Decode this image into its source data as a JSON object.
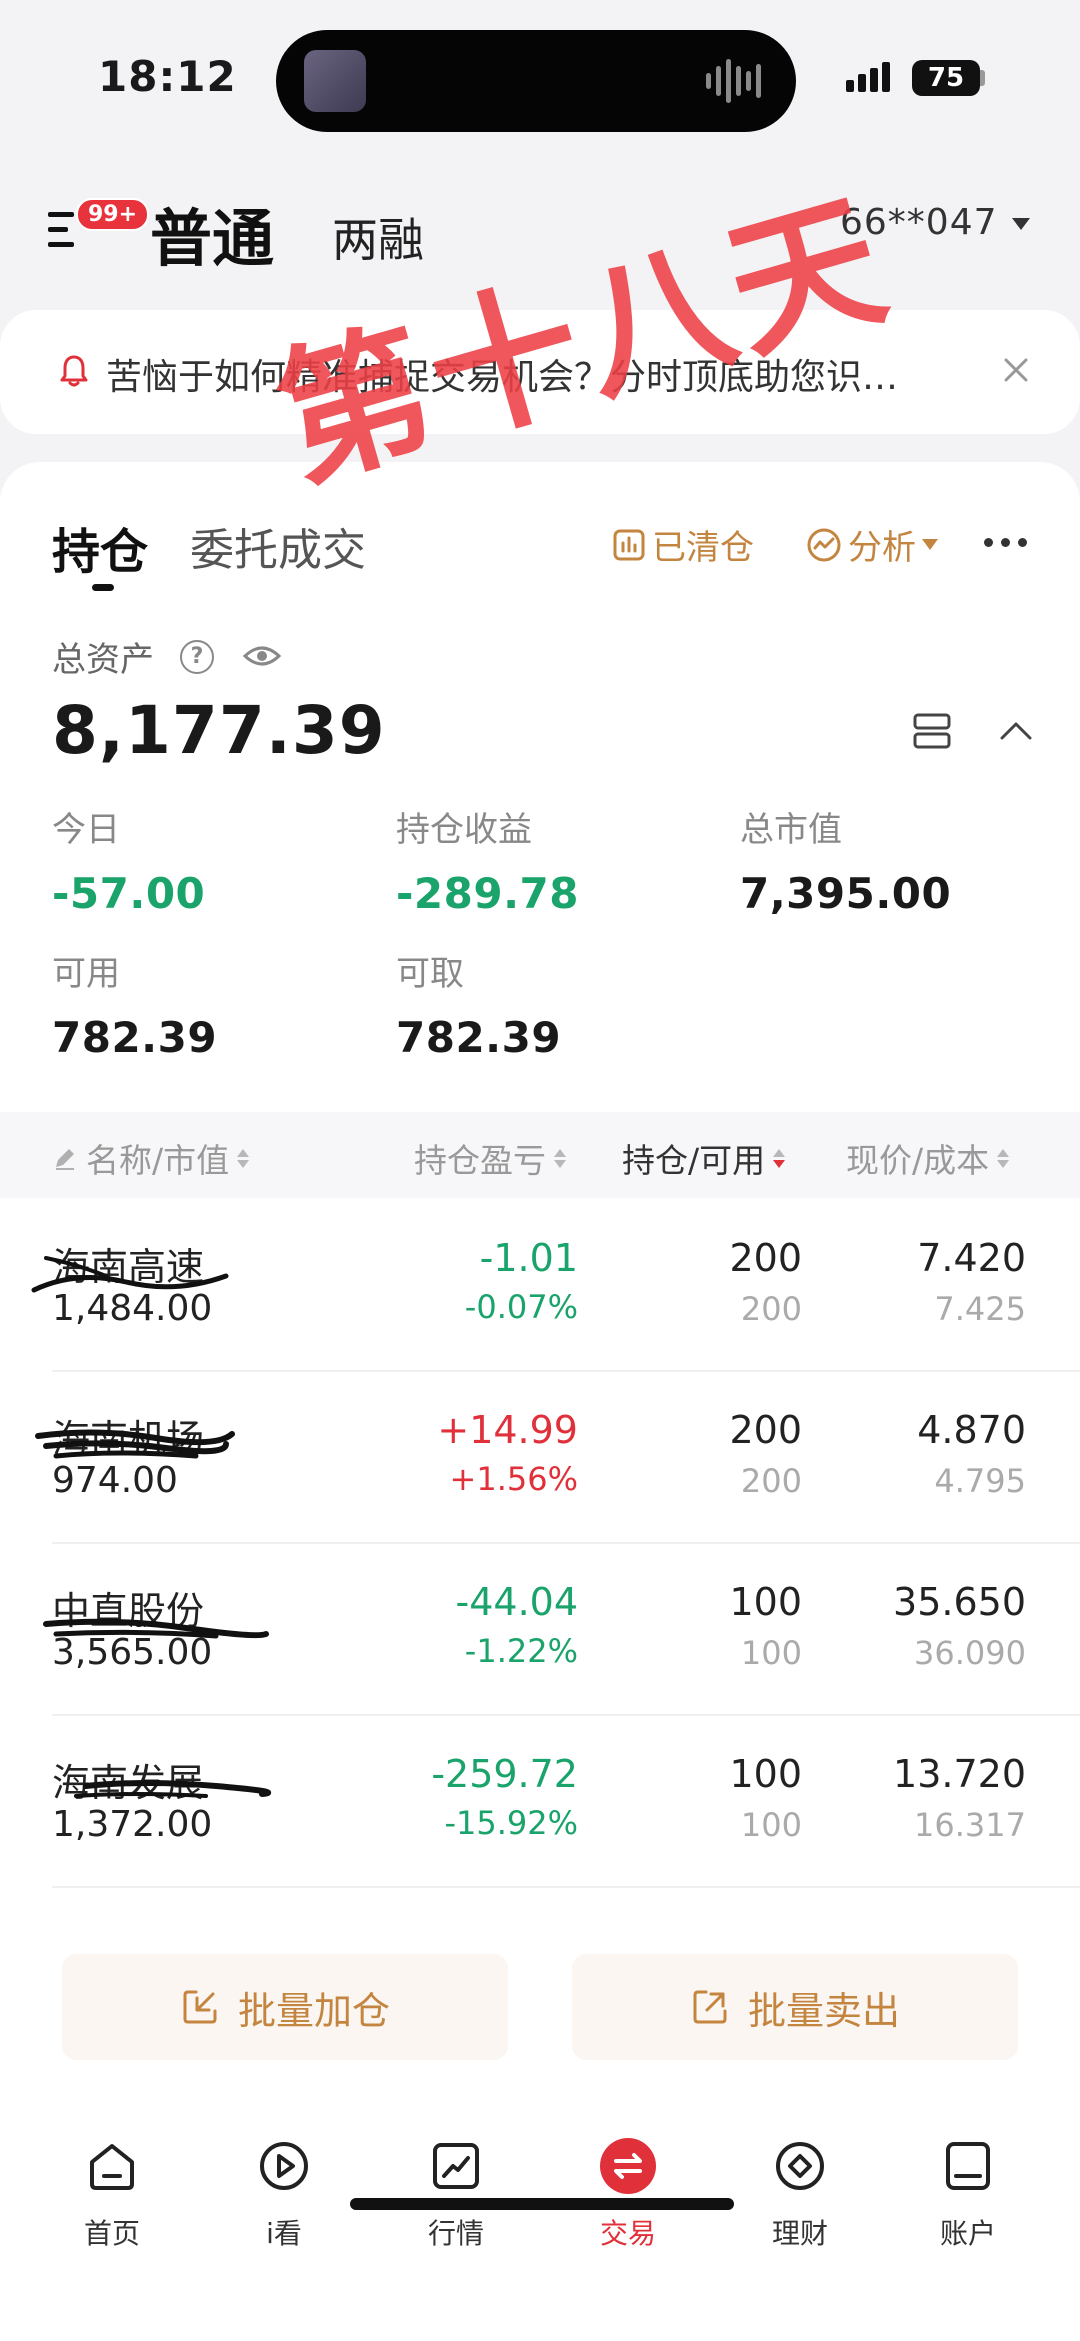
{
  "status_bar": {
    "time": "18:12",
    "battery": "75"
  },
  "header": {
    "badge": "99+",
    "tab_normal": "普通",
    "tab_margin": "两融",
    "account": "66**047"
  },
  "notice": {
    "text": "苦恼于如何精准捕捉交易机会？分时顶底助您识…"
  },
  "tabs": {
    "holdings": "持仓",
    "orders": "委托成交"
  },
  "actions": {
    "cleared": "已清仓",
    "analysis": "分析"
  },
  "assets": {
    "total_label": "总资产",
    "total_value": "8,177.39",
    "today_label": "今日",
    "today_value": "-57.00",
    "position_pl_label": "持仓收益",
    "position_pl_value": "-289.78",
    "market_value_label": "总市值",
    "market_value_value": "7,395.00",
    "available_label": "可用",
    "available_value": "782.39",
    "withdrawable_label": "可取",
    "withdrawable_value": "782.39"
  },
  "table": {
    "headers": [
      "名称/市值",
      "持仓盈亏",
      "持仓/可用",
      "现价/成本"
    ],
    "rows": [
      {
        "name": "海南高速",
        "market_value": "1,484.00",
        "pl": "-1.01",
        "pl_pct": "-0.07%",
        "position": "200",
        "available": "200",
        "price": "7.420",
        "cost": "7.425",
        "trend": "down"
      },
      {
        "name": "海南机场",
        "market_value": "974.00",
        "pl": "+14.99",
        "pl_pct": "+1.56%",
        "position": "200",
        "available": "200",
        "price": "4.870",
        "cost": "4.795",
        "trend": "up"
      },
      {
        "name": "中直股份",
        "market_value": "3,565.00",
        "pl": "-44.04",
        "pl_pct": "-1.22%",
        "position": "100",
        "available": "100",
        "price": "35.650",
        "cost": "36.090",
        "trend": "down"
      },
      {
        "name": "海南发展",
        "market_value": "1,372.00",
        "pl": "-259.72",
        "pl_pct": "-15.92%",
        "position": "100",
        "available": "100",
        "price": "13.720",
        "cost": "16.317",
        "trend": "down"
      }
    ]
  },
  "batch": {
    "add": "批量加仓",
    "sell": "批量卖出"
  },
  "watermark": "第十八天",
  "nav": [
    {
      "label": "首页",
      "icon": "home-icon"
    },
    {
      "label": "i看",
      "icon": "play-icon"
    },
    {
      "label": "行情",
      "icon": "chart-icon"
    },
    {
      "label": "交易",
      "icon": "trade-icon"
    },
    {
      "label": "理财",
      "icon": "wealth-icon"
    },
    {
      "label": "账户",
      "icon": "account-icon"
    }
  ],
  "colors": {
    "gain": "#e0303a",
    "loss": "#1aa36a",
    "accent": "#c3853f"
  }
}
